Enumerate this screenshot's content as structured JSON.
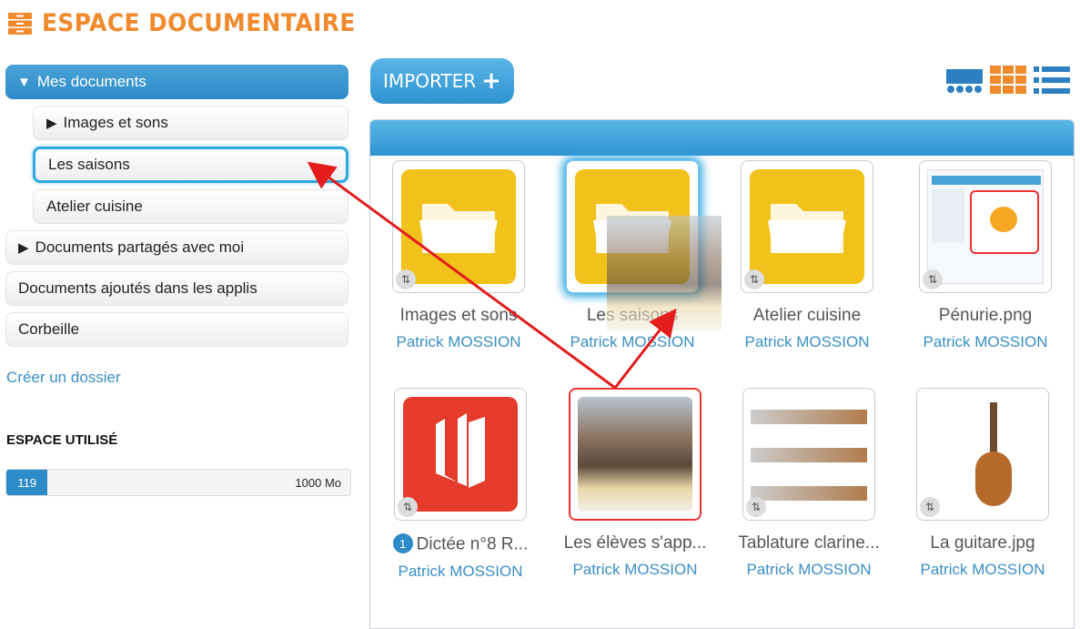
{
  "header": {
    "title": "ESPACE DOCUMENTAIRE",
    "logo_icon": "drawer-icon",
    "color": "#f08a2c"
  },
  "sidebar": {
    "root": {
      "label": "Mes documents",
      "expanded": true
    },
    "children": [
      {
        "label": "Images et sons",
        "collapsed": true
      },
      {
        "label": "Les saisons",
        "selected": true
      },
      {
        "label": "Atelier cuisine"
      }
    ],
    "shared": {
      "label": "Documents partagés avec moi"
    },
    "apps": {
      "label": "Documents ajoutés dans les applis"
    },
    "trash": {
      "label": "Corbeille"
    },
    "create_folder": "Créer un dossier"
  },
  "storage": {
    "title": "ESPACE UTILISÉ",
    "used": "119",
    "total": "1000 Mo",
    "fraction": 0.119
  },
  "toolbar": {
    "import_label": "IMPORTER",
    "view_icons": [
      "icons-view-icon",
      "grid-view-icon",
      "list-view-icon"
    ]
  },
  "files": [
    {
      "name": "Images et sons",
      "owner": "Patrick MOSSION",
      "type": "folder"
    },
    {
      "name": "Les saisons",
      "owner": "Patrick MOSSION",
      "type": "folder"
    },
    {
      "name": "Atelier cuisine",
      "owner": "Patrick MOSSION",
      "type": "folder"
    },
    {
      "name": "Pénurie.png",
      "owner": "Patrick MOSSION",
      "type": "image"
    },
    {
      "name": "Dictée n°8 R...",
      "owner": "Patrick MOSSION",
      "type": "app",
      "badge": "1"
    },
    {
      "name": "Les élèves s'app...",
      "owner": "Patrick MOSSION",
      "type": "photo"
    },
    {
      "name": "Tablature clarine...",
      "owner": "Patrick MOSSION",
      "type": "image"
    },
    {
      "name": "La guitare.jpg",
      "owner": "Patrick MOSSION",
      "type": "image"
    }
  ]
}
